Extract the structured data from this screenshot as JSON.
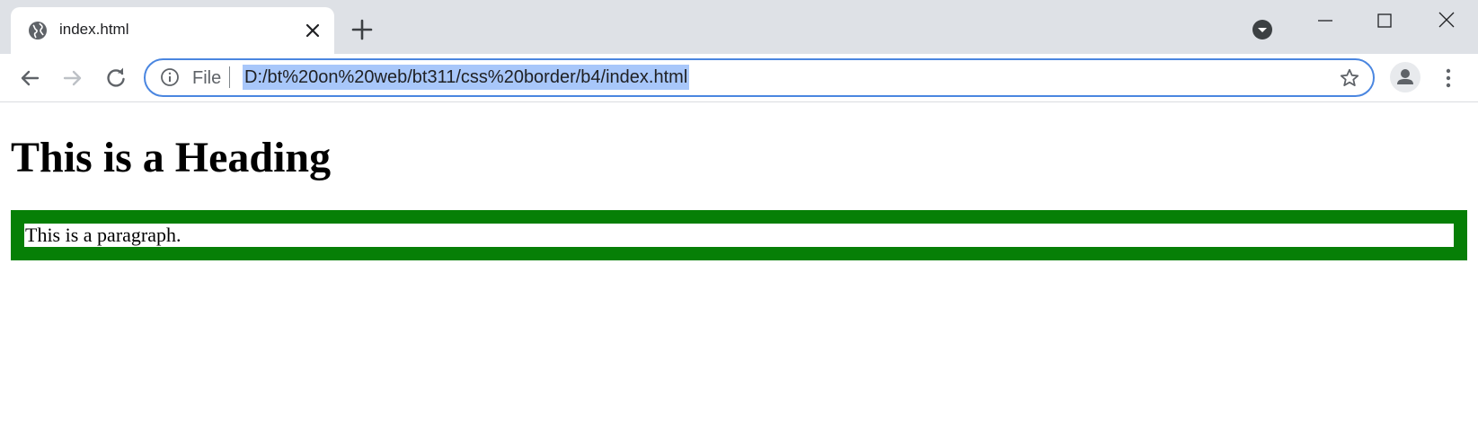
{
  "tab": {
    "title": "index.html",
    "favicon_icon": "globe-icon",
    "close_icon": "close-icon"
  },
  "tabstrip": {
    "new_tab_icon": "plus-icon",
    "tab_search_icon": "chevron-down-circle-icon"
  },
  "window_controls": {
    "minimize_icon": "minimize-icon",
    "maximize_icon": "maximize-icon",
    "close_icon": "window-close-icon"
  },
  "toolbar": {
    "back_icon": "arrow-left-icon",
    "forward_icon": "arrow-right-icon",
    "reload_icon": "reload-icon",
    "profile_icon": "person-icon",
    "menu_icon": "kebab-menu-icon"
  },
  "omnibox": {
    "info_icon": "info-icon",
    "scheme_label": "File",
    "url": "D:/bt%20on%20web/bt311/css%20border/b4/index.html",
    "star_icon": "star-icon",
    "focus_color": "#4a86e0",
    "selection_color": "#a8c7fa"
  },
  "page": {
    "heading": "This is a Heading",
    "paragraph": "This is a paragraph.",
    "border_color": "#067f06"
  }
}
